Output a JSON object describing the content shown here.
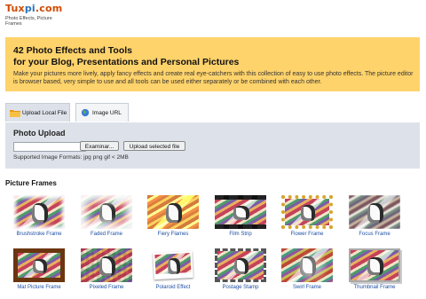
{
  "logo": {
    "word_a": "Tux",
    "word_b": "pi",
    "word_c": ".com",
    "tagline": "Photo Effects, Picture Frames"
  },
  "intro": {
    "title_line1": "42 Photo Effects and Tools",
    "title_line2": "for your Blog, Presentations and Personal Pictures",
    "body": "Make your pictures more lively, apply fancy effects and create real eye-catchers with this collection of easy to use photo effects. The picture editor is browser based, very simple to use and all tools can be used either separately or be combined with each other."
  },
  "tabs": [
    {
      "label": "Upload Local File",
      "icon": "folder-icon"
    },
    {
      "label": "Image URL",
      "icon": "globe-icon"
    }
  ],
  "upload": {
    "title": "Photo Upload",
    "browse_label": "Examinar...",
    "upload_label": "Upload selected file",
    "formats": "Supported Image Formats: jpg png gif < 2MB"
  },
  "frames": {
    "section_title": "Picture Frames",
    "items": [
      {
        "label": "Brushstroke Frame"
      },
      {
        "label": "Faded Frame"
      },
      {
        "label": "Fiery Flames"
      },
      {
        "label": "Film Strip"
      },
      {
        "label": "Flower Frame"
      },
      {
        "label": "Focus Frame"
      },
      {
        "label": "Mat Picture Frame"
      },
      {
        "label": "Pixeled Frame"
      },
      {
        "label": "Polaroid Effect"
      },
      {
        "label": "Postage Stamp"
      },
      {
        "label": "Swirl Frame"
      },
      {
        "label": "Thumbnail Frame"
      }
    ]
  },
  "colors": {
    "banner": "#ffd36b",
    "panel": "#dde2ea",
    "link": "#1d4fa3"
  }
}
